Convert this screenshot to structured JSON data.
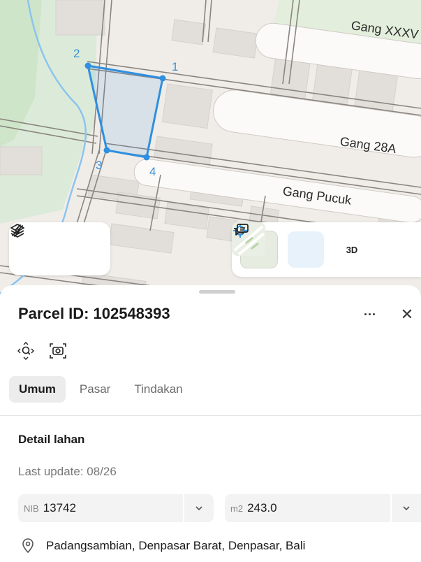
{
  "map": {
    "roads": [
      "Gang XXXV",
      "Gang 28A",
      "Gang Pucuk"
    ],
    "vertices": [
      "1",
      "2",
      "3",
      "4"
    ],
    "parcel_color": "#2f8fe0"
  },
  "toolbar_left": {
    "icons": [
      "layers-icon",
      "measure-icon"
    ]
  },
  "toolbar_right": {
    "three_d_label": "3D",
    "icons": [
      "satellite-thumbnail",
      "locate-icon",
      "3d-button",
      "feedback-icon"
    ]
  },
  "parcel": {
    "title_label": "Parcel ID:",
    "id": "102548393",
    "more_label": "···",
    "close_label": "✕"
  },
  "tabs": [
    {
      "label": "Umum",
      "active": true
    },
    {
      "label": "Pasar",
      "active": false
    },
    {
      "label": "Tindakan",
      "active": false
    }
  ],
  "details": {
    "heading": "Detail lahan",
    "last_update": "Last update: 08/26",
    "nib_prefix": "NIB",
    "nib_value": "13742",
    "area_prefix": "m2",
    "area_value": "243.0",
    "address": "Padangsambian, Denpasar Barat, Denpasar, Bali"
  }
}
